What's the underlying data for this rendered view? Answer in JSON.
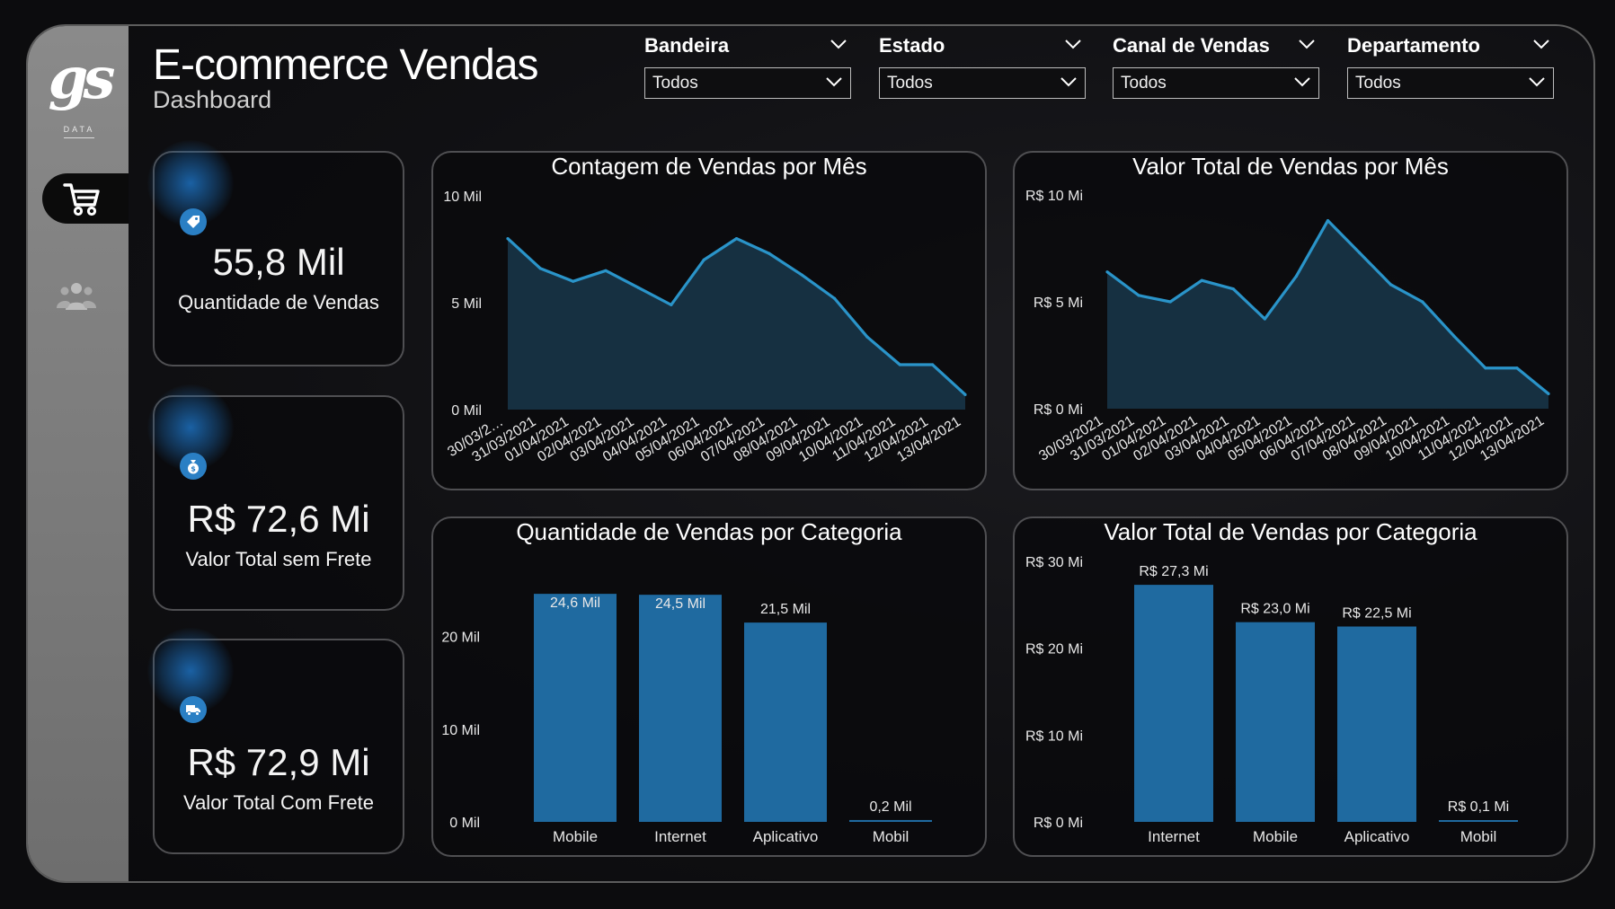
{
  "header": {
    "title": "E-commerce Vendas",
    "subtitle": "Dashboard"
  },
  "logo": {
    "mark": "gs",
    "sub": "DATA"
  },
  "nav": [
    {
      "icon": "cart-icon",
      "active": true
    },
    {
      "icon": "users-icon",
      "active": false
    }
  ],
  "filters": [
    {
      "label": "Bandeira",
      "value": "Todos"
    },
    {
      "label": "Estado",
      "value": "Todos"
    },
    {
      "label": "Canal de Vendas",
      "value": "Todos"
    },
    {
      "label": "Departamento",
      "value": "Todos"
    }
  ],
  "kpis": [
    {
      "value": "55,8 Mil",
      "caption": "Quantidade de Vendas",
      "icon": "tag-icon"
    },
    {
      "value": "R$ 72,6 Mi",
      "caption": "Valor Total sem Frete",
      "icon": "money-bag-icon"
    },
    {
      "value": "R$ 72,9 Mi",
      "caption": "Valor Total Com Frete",
      "icon": "truck-icon"
    }
  ],
  "colors": {
    "accent": "#2a94c9",
    "area": "#173447",
    "bar": "#1f6aa0",
    "border": "#4f4f52"
  },
  "chart_data": [
    {
      "type": "area",
      "title": "Contagem de Vendas por Mês",
      "x": [
        "30/03/2…",
        "31/03/2021",
        "01/04/2021",
        "02/04/2021",
        "03/04/2021",
        "04/04/2021",
        "05/04/2021",
        "06/04/2021",
        "07/04/2021",
        "08/04/2021",
        "09/04/2021",
        "10/04/2021",
        "11/04/2021",
        "12/04/2021",
        "13/04/2021"
      ],
      "values": [
        8000,
        6600,
        6000,
        6500,
        5700,
        4900,
        7000,
        8000,
        7300,
        6300,
        5200,
        3400,
        2100,
        2100,
        700
      ],
      "ylim": [
        0,
        10000
      ],
      "yticks": [
        {
          "v": 0,
          "label": "0 Mil"
        },
        {
          "v": 5000,
          "label": "5 Mil"
        },
        {
          "v": 10000,
          "label": "10 Mil"
        }
      ],
      "grid": false
    },
    {
      "type": "area",
      "title": "Valor Total de Vendas por Mês",
      "x": [
        "30/03/2021",
        "31/03/2021",
        "01/04/2021",
        "02/04/2021",
        "03/04/2021",
        "04/04/2021",
        "05/04/2021",
        "06/04/2021",
        "07/04/2021",
        "08/04/2021",
        "09/04/2021",
        "10/04/2021",
        "11/04/2021",
        "12/04/2021",
        "13/04/2021"
      ],
      "values": [
        6400,
        5300,
        5000,
        6000,
        5600,
        4200,
        6200,
        8800,
        7300,
        5800,
        5000,
        3400,
        1900,
        1900,
        700
      ],
      "ylim": [
        0,
        10000
      ],
      "yticks": [
        {
          "v": 0,
          "label": "R$ 0 Mi"
        },
        {
          "v": 5000,
          "label": "R$ 5 Mi"
        },
        {
          "v": 10000,
          "label": "R$ 10 Mi"
        }
      ],
      "grid": false
    },
    {
      "type": "bar",
      "title": "Quantidade de Vendas por Categoria",
      "categories": [
        "Mobile",
        "Internet",
        "Aplicativo",
        "Mobil"
      ],
      "values": [
        24.6,
        24.5,
        21.5,
        0.2
      ],
      "labels": [
        "24,6 Mil",
        "24,5 Mil",
        "21,5 Mil",
        "0,2 Mil"
      ],
      "ylim": [
        0,
        25
      ],
      "yticks": [
        {
          "v": 0,
          "label": "0 Mil"
        },
        {
          "v": 10,
          "label": "10 Mil"
        },
        {
          "v": 20,
          "label": "20 Mil"
        }
      ],
      "grid": false
    },
    {
      "type": "bar",
      "title": "Valor Total de Vendas por Categoria",
      "categories": [
        "Internet",
        "Mobile",
        "Aplicativo",
        "Mobil"
      ],
      "values": [
        27.3,
        23.0,
        22.5,
        0.1
      ],
      "labels": [
        "R$ 27,3 Mi",
        "R$ 23,0 Mi",
        "R$ 22,5 Mi",
        "R$ 0,1 Mi"
      ],
      "ylim": [
        0,
        30
      ],
      "yticks": [
        {
          "v": 0,
          "label": "R$ 0 Mi"
        },
        {
          "v": 10,
          "label": "R$ 10 Mi"
        },
        {
          "v": 20,
          "label": "R$ 20 Mi"
        },
        {
          "v": 30,
          "label": "R$ 30 Mi"
        }
      ],
      "grid": false
    }
  ]
}
